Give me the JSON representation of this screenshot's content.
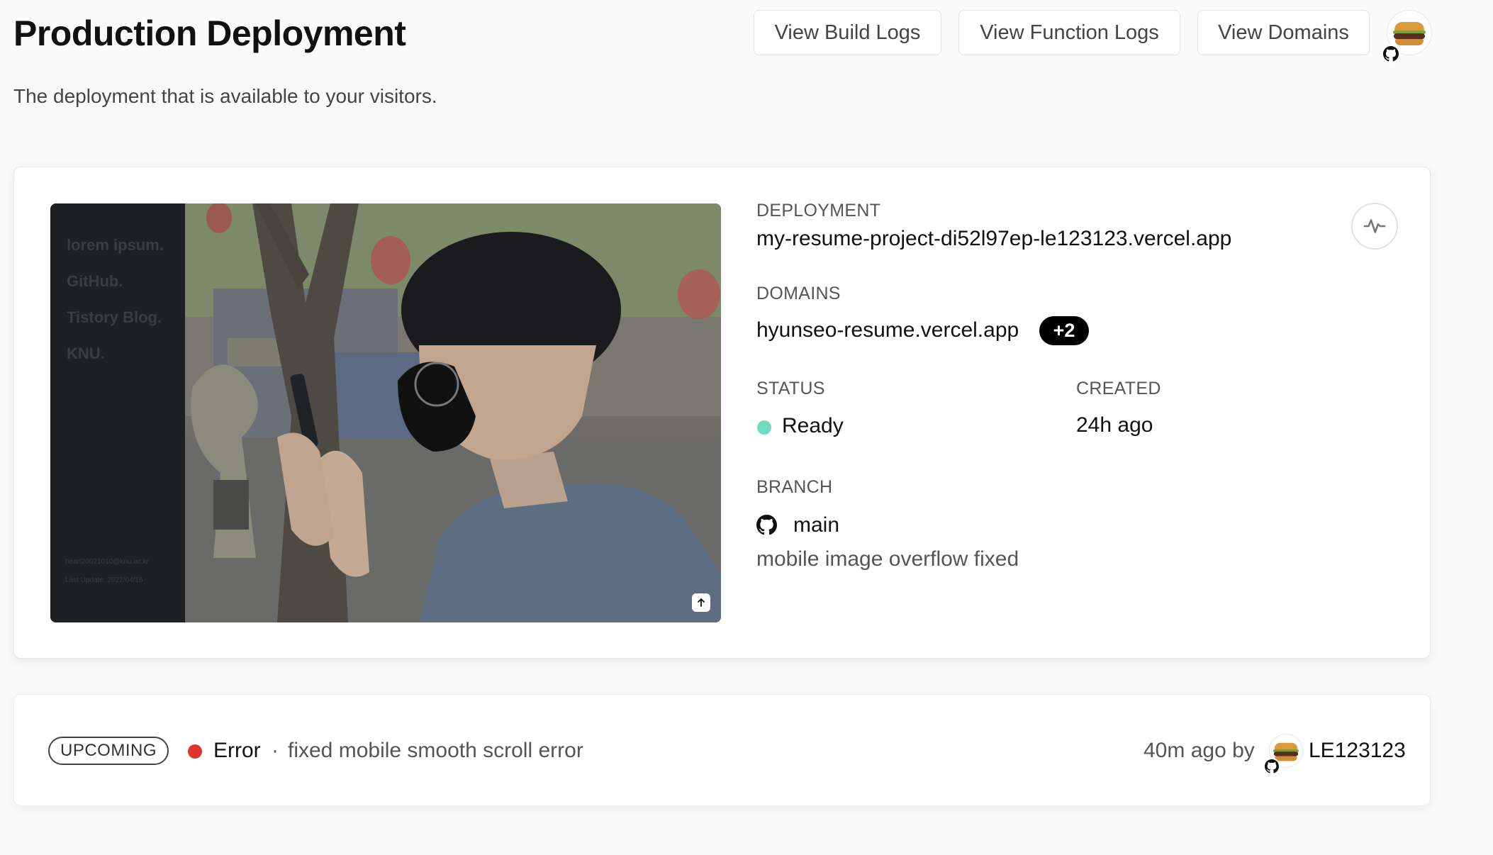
{
  "header": {
    "title": "Production Deployment",
    "subtitle": "The deployment that is available to your visitors.",
    "buttons": {
      "build_logs": "View Build Logs",
      "function_logs": "View Function Logs",
      "domains": "View Domains"
    }
  },
  "deployment": {
    "preview": {
      "nav_items": [
        "lorem ipsum.",
        "GitHub.",
        "Tistory Blog.",
        "KNU."
      ],
      "footer_email": "heart20021010@knu.ac.kr",
      "footer_update": "Last Update: 2022/04/16"
    },
    "deployment_label": "DEPLOYMENT",
    "deployment_url": "my-resume-project-di52l97ep-le123123.vercel.app",
    "domains_label": "DOMAINS",
    "domain": "hyunseo-resume.vercel.app",
    "domains_more": "+2",
    "status_label": "STATUS",
    "status": "Ready",
    "status_color": "#6fdcc0",
    "created_label": "CREATED",
    "created": "24h ago",
    "branch_label": "BRANCH",
    "branch": "main",
    "commit_message": "mobile image overflow fixed"
  },
  "upcoming": {
    "badge": "UPCOMING",
    "status": "Error",
    "status_color": "#e0352b",
    "separator": "·",
    "message": "fixed mobile smooth scroll error",
    "time": "40m ago by",
    "author": "LE123123"
  },
  "icons": {
    "avatar": "burger-avatar-icon",
    "github": "github-icon",
    "activity": "activity-icon",
    "upload": "upload-arrow-icon"
  }
}
